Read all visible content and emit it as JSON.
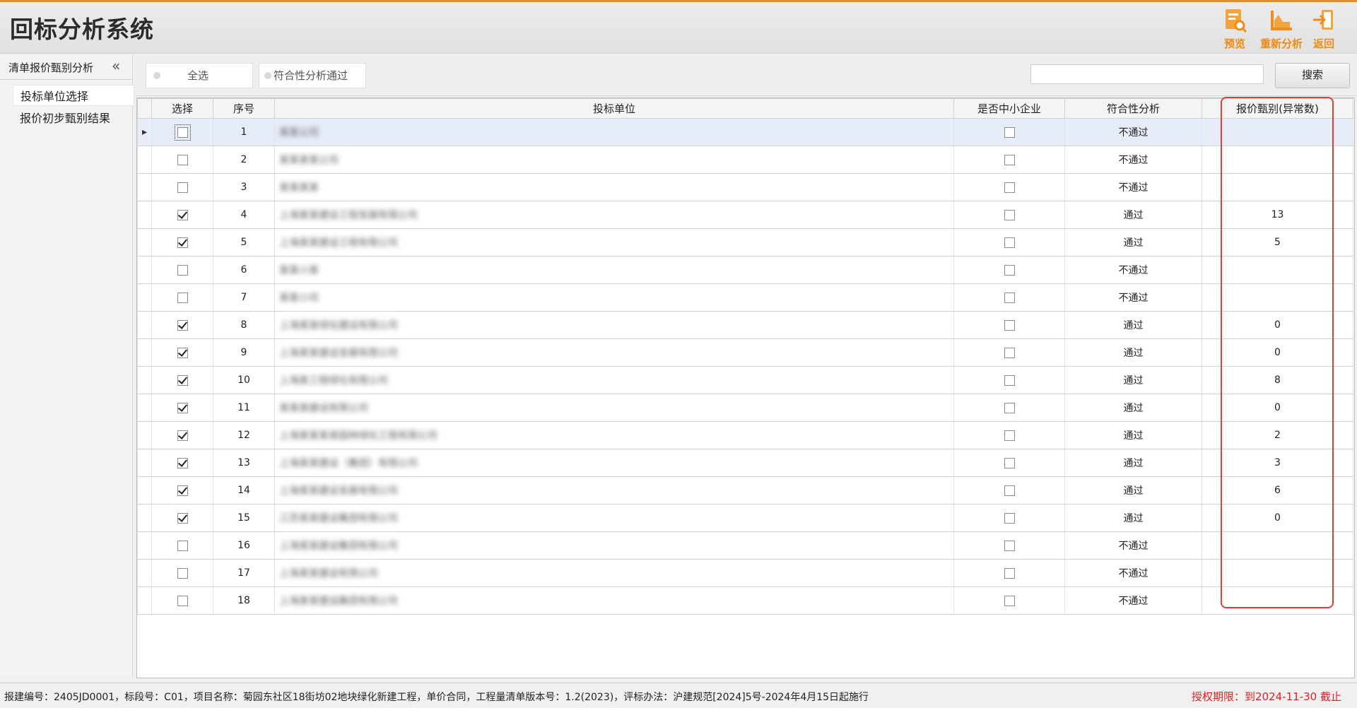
{
  "app": {
    "title": "回标分析系统"
  },
  "header_buttons": [
    {
      "label": "预览",
      "icon": "preview-icon"
    },
    {
      "label": "重新分析",
      "icon": "chart-reanalyze-icon"
    },
    {
      "label": "返回",
      "icon": "exit-icon"
    }
  ],
  "sidebar": {
    "section_title": "清单报价甄别分析",
    "collapse_icon": "double-chevron-left-icon",
    "items": [
      {
        "label": "投标单位选择",
        "active": true
      },
      {
        "label": "报价初步甄别结果",
        "active": false
      }
    ]
  },
  "toolbar": {
    "select_all_label": "全选",
    "filter_pass_label": "符合性分析通过",
    "search_value": "",
    "search_label": "搜索"
  },
  "grid": {
    "columns": [
      "选择",
      "序号",
      "投标单位",
      "是否中小企业",
      "符合性分析",
      "报价甄别(异常数)"
    ],
    "rows": [
      {
        "checked": false,
        "no": "1",
        "unit": "某某公司",
        "sme": false,
        "compliance": "不通过",
        "anomalies": ""
      },
      {
        "checked": false,
        "no": "2",
        "unit": "某某某某公司",
        "sme": false,
        "compliance": "不通过",
        "anomalies": ""
      },
      {
        "checked": false,
        "no": "3",
        "unit": "某某某某",
        "sme": false,
        "compliance": "不通过",
        "anomalies": ""
      },
      {
        "checked": true,
        "no": "4",
        "unit": "上海某某建设工程发展有限公司",
        "sme": false,
        "compliance": "通过",
        "anomalies": "13"
      },
      {
        "checked": true,
        "no": "5",
        "unit": "上海某某建设工程有限公司",
        "sme": false,
        "compliance": "通过",
        "anomalies": "5"
      },
      {
        "checked": false,
        "no": "6",
        "unit": "某某小某",
        "sme": false,
        "compliance": "不通过",
        "anomalies": ""
      },
      {
        "checked": false,
        "no": "7",
        "unit": "某某小司",
        "sme": false,
        "compliance": "不通过",
        "anomalies": ""
      },
      {
        "checked": true,
        "no": "8",
        "unit": "上海某某绿化建设有限公司",
        "sme": false,
        "compliance": "通过",
        "anomalies": "0"
      },
      {
        "checked": true,
        "no": "9",
        "unit": "上海某某建设发展有限公司",
        "sme": false,
        "compliance": "通过",
        "anomalies": "0"
      },
      {
        "checked": true,
        "no": "10",
        "unit": "上海某工程绿化有限公司",
        "sme": false,
        "compliance": "通过",
        "anomalies": "8"
      },
      {
        "checked": true,
        "no": "11",
        "unit": "某某某建设有限公司",
        "sme": false,
        "compliance": "通过",
        "anomalies": "0"
      },
      {
        "checked": true,
        "no": "12",
        "unit": "上海某某某某园林绿化工程有限公司",
        "sme": false,
        "compliance": "通过",
        "anomalies": "2"
      },
      {
        "checked": true,
        "no": "13",
        "unit": "上海某某建设（集团）有限公司",
        "sme": false,
        "compliance": "通过",
        "anomalies": "3"
      },
      {
        "checked": true,
        "no": "14",
        "unit": "上海某某建设发展有限公司",
        "sme": false,
        "compliance": "通过",
        "anomalies": "6"
      },
      {
        "checked": true,
        "no": "15",
        "unit": "江苏某某建设集团有限公司",
        "sme": false,
        "compliance": "通过",
        "anomalies": "0"
      },
      {
        "checked": false,
        "no": "16",
        "unit": "上海某某建设集团有限公司",
        "sme": false,
        "compliance": "不通过",
        "anomalies": ""
      },
      {
        "checked": false,
        "no": "17",
        "unit": "上海某某建设有限公司",
        "sme": false,
        "compliance": "不通过",
        "anomalies": ""
      },
      {
        "checked": false,
        "no": "18",
        "unit": "上海某某建设集团有限公司",
        "sme": false,
        "compliance": "不通过",
        "anomalies": ""
      }
    ]
  },
  "status": {
    "info": "报建编号：2405JD0001，标段号：C01，项目名称：菊园东社区18街坊02地块绿化新建工程，单价合同，工程量清单版本号：1.2(2023)，评标办法：沪建规范[2024]5号-2024年4月15日起施行",
    "license": "授权期限：到2024-11-30 截止"
  },
  "colors": {
    "accent": "#f08c1e",
    "highlight": "#e53b3b",
    "license": "#e02020",
    "selected_row": "#e6ecf8"
  }
}
